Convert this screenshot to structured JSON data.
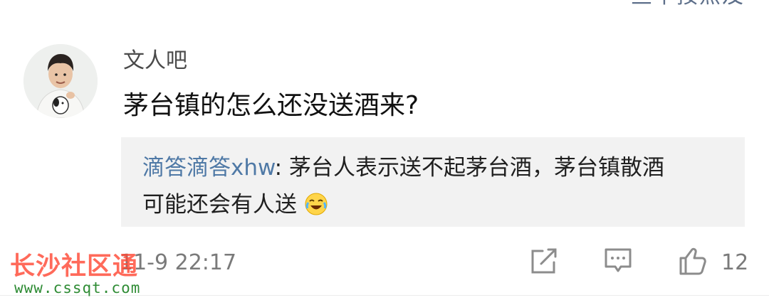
{
  "comment": {
    "username": "文人吧",
    "text": "茅台镇的怎么还没送酒来?",
    "avatar_icon": "child-photo-avatar"
  },
  "reply": {
    "author": "滴答滴答xhw",
    "separator": ": ",
    "line1_text": "茅台人表示送不起茅台酒，茅台镇散酒",
    "line2_text": "可能还会有人送",
    "emoji": "laughing-crying-emoji"
  },
  "footer": {
    "timestamp": "11-9 22:17",
    "share_icon": "share-icon",
    "reply_icon": "comment-icon",
    "like_icon": "thumbs-up-icon",
    "like_count": "12"
  },
  "watermark": {
    "title": "长沙社区通",
    "url": "www.cssqt.com"
  },
  "top_cut_text": "旦中按点及",
  "colors": {
    "reply_author": "#4f79a6",
    "reply_bg": "#f2f2f2",
    "watermark_red": "#ff4a36",
    "watermark_green": "#2f8c35"
  }
}
